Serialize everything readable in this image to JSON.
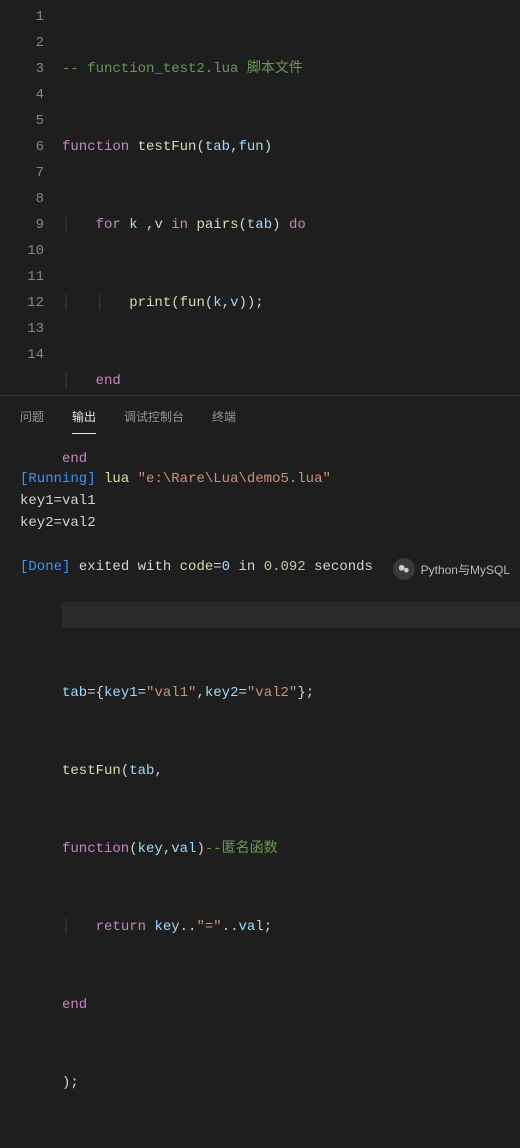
{
  "editor": {
    "lines": [
      1,
      2,
      3,
      4,
      5,
      6,
      7,
      8,
      9,
      10,
      11,
      12,
      13,
      14
    ],
    "code": {
      "l1": {
        "comment": "-- function_test2.lua 脚本文件"
      },
      "l2": {
        "kw1": "function",
        "fn": "testFun",
        "p": "(",
        "a1": "tab",
        "c": ",",
        "a2": "fun",
        "p2": ")"
      },
      "l3": {
        "kw1": "for",
        "v1": "k",
        "c1": " ,",
        "v2": "v",
        "kw2": "in",
        "fn": "pairs",
        "p": "(",
        "a": "tab",
        "p2": ")",
        "kw3": "do"
      },
      "l4": {
        "fn": "print",
        "p": "(",
        "fn2": "fun",
        "p2": "(",
        "a1": "k",
        "c": ",",
        "a2": "v",
        "p3": "));"
      },
      "l5": {
        "kw": "end"
      },
      "l6": {
        "kw": "end"
      },
      "l9": {
        "v": "tab",
        "eq": "=",
        "p": "{",
        "k1": "key1",
        "eq2": "=",
        "s1": "\"val1\"",
        "c": ",",
        "k2": "key2",
        "eq3": "=",
        "s2": "\"val2\"",
        "p2": "};"
      },
      "l10": {
        "fn": "testFun",
        "p": "(",
        "a": "tab",
        "c": ","
      },
      "l11": {
        "kw": "function",
        "p": "(",
        "a1": "key",
        "c": ",",
        "a2": "val",
        "p2": ")",
        "cm": "--匿名函数"
      },
      "l12": {
        "kw": "return",
        "v1": "key",
        "op1": "..",
        "s": "\"=\"",
        "op2": "..",
        "v2": "val",
        "sc": ";"
      },
      "l13": {
        "kw": "end"
      },
      "l14": {
        "p": ");"
      }
    }
  },
  "panel": {
    "tabs": {
      "problems": "问题",
      "output": "输出",
      "debug": "调试控制台",
      "terminal": "终端"
    },
    "output": {
      "running_label": "[Running]",
      "cmd": "lua",
      "path": "\"e:\\Rare\\Lua\\demo5.lua\"",
      "line1": "key1=val1",
      "line2": "key2=val2",
      "done_label": "[Done]",
      "exited": "exited with",
      "code_word": "code",
      "eq": "=",
      "code_val": "0",
      "in": "in",
      "time": "0.092",
      "seconds": "seconds"
    }
  },
  "watermark": {
    "text": "Python与MySQL"
  }
}
